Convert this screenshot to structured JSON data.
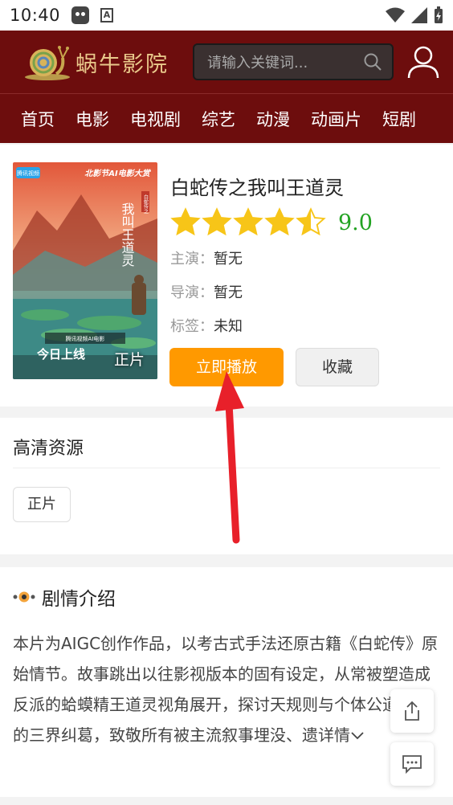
{
  "status_bar": {
    "time": "10:40"
  },
  "header": {
    "logo_text": "蜗牛影院",
    "search_placeholder": "请输入关键词..."
  },
  "nav": {
    "items": [
      "首页",
      "电影",
      "电视剧",
      "综艺",
      "动漫",
      "动画片",
      "短剧"
    ]
  },
  "detail": {
    "title": "白蛇传之我叫王道灵",
    "rating": 4.5,
    "score": "9.0",
    "cast_label": "主演：",
    "cast_value": "暂无",
    "director_label": "导演：",
    "director_value": "暂无",
    "tags_label": "标签：",
    "tags_value": "未知",
    "poster_badge": "正片",
    "poster_texts": {
      "top_badge": "腾讯视频",
      "festival": "北影节AI电影大赏",
      "vertical_title": "我叫王道灵",
      "seal": "白蛇传之",
      "caption": "腾讯视频AI电影",
      "online": "今日上线"
    },
    "play_label": "立即播放",
    "favorite_label": "收藏"
  },
  "sources": {
    "title": "高清资源",
    "episodes": [
      "正片"
    ]
  },
  "plot": {
    "title": "剧情介绍",
    "text": "本片为AIGC创作作品，以考古式手法还原古籍《白蛇传》原始情节。故事跳出以往影视版本的固有设定，从常被塑造成反派的蛤蟆精王道灵视角展开，探讨天规则与个体公道之间的三界纠葛，致敬所有被主流叙事埋没、遗",
    "more_label": "详情"
  },
  "colors": {
    "header_bg": "#6d0d0d",
    "play_button": "#ff9900",
    "score": "#22a322",
    "star": "#f7c518",
    "annotation_arrow": "#e8202a"
  }
}
